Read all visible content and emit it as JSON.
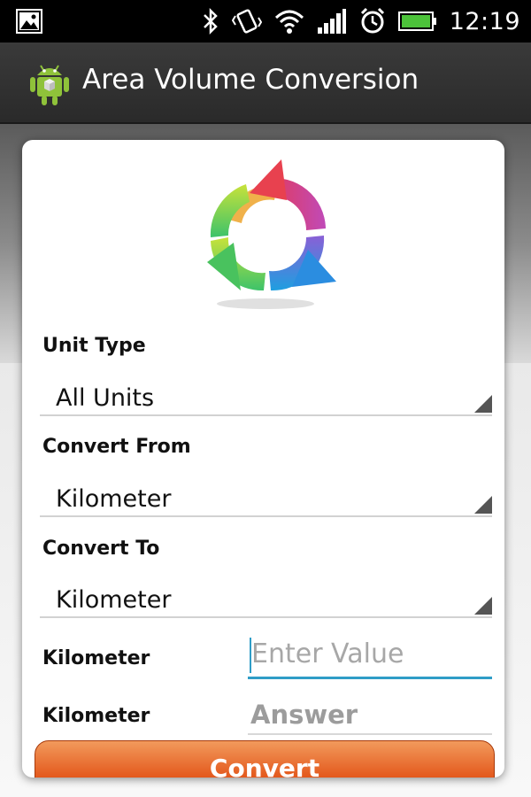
{
  "status_bar": {
    "time": "12:19",
    "icons": [
      "picture-notification-icon",
      "bluetooth-icon",
      "vibrate-icon",
      "wifi-icon",
      "signal-icon",
      "alarm-icon",
      "battery-icon"
    ]
  },
  "app": {
    "title": "Area Volume Conversion",
    "icon": "android-app-icon"
  },
  "form": {
    "unit_type": {
      "label": "Unit Type",
      "selected": "All Units"
    },
    "convert_from": {
      "label": "Convert From",
      "selected": "Kilometer"
    },
    "convert_to": {
      "label": "Convert To",
      "selected": "Kilometer"
    },
    "input_row": {
      "label": "Kilometer",
      "placeholder": "Enter Value",
      "value": ""
    },
    "answer_row": {
      "label": "Kilometer",
      "answer": "Answer"
    },
    "convert_button": "Convert"
  },
  "colors": {
    "accent": "#2f9dc7",
    "button": "#e3581c",
    "action_bar": "#333333"
  }
}
